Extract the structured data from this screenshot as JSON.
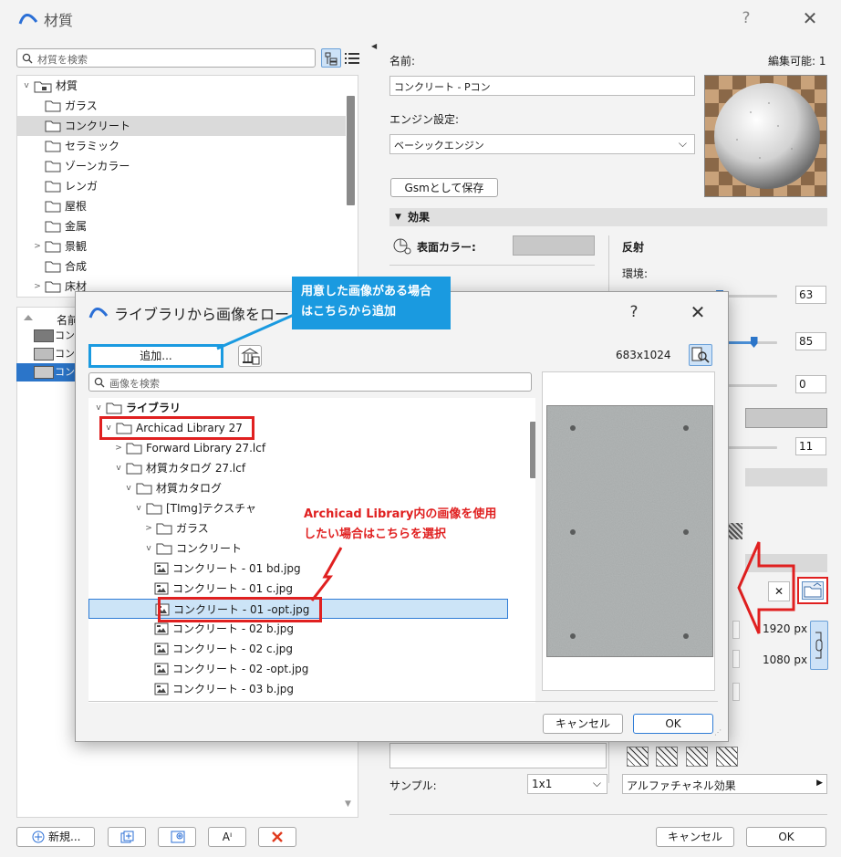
{
  "window": {
    "title": "材質",
    "help": "?",
    "close": "✕"
  },
  "left_pane": {
    "search_placeholder": "材質を検索",
    "tree": {
      "root": "材質",
      "items": [
        {
          "label": "ガラス",
          "expandable": false
        },
        {
          "label": "コンクリート",
          "expandable": false,
          "selected": true
        },
        {
          "label": "セラミック",
          "expandable": false
        },
        {
          "label": "ゾーンカラー",
          "expandable": false
        },
        {
          "label": "レンガ",
          "expandable": false
        },
        {
          "label": "屋根",
          "expandable": false
        },
        {
          "label": "金属",
          "expandable": false
        },
        {
          "label": "景観",
          "expandable": true
        },
        {
          "label": "合成",
          "expandable": false
        },
        {
          "label": "床材",
          "expandable": true
        }
      ]
    },
    "list_header": "名前",
    "list_rows": [
      {
        "label": "コンクリート",
        "swatch": "#7a7a7a"
      },
      {
        "label": "コンクリート",
        "swatch": "#bdbdbd"
      },
      {
        "label": "コンクリート",
        "swatch": "#c9c9c9",
        "selected": true
      }
    ],
    "bottom_buttons": {
      "new": "新規...",
      "rename": "Aᴵ"
    }
  },
  "right_pane": {
    "name_label": "名前:",
    "editable_label": "編集可能: 1",
    "name_value": "コンクリート - Pコン",
    "engine_label": "エンジン設定:",
    "engine_value": "ベーシックエンジン",
    "gsm_button": "Gsmとして保存",
    "effects_header": "効果",
    "surface_color_label": "表面カラー:",
    "reflection_label": "反射",
    "ambient_label": "環境:",
    "sliders": [
      {
        "value": "63",
        "fraction": 0.63
      },
      {
        "value": "85",
        "fraction": 0.85
      },
      {
        "value": "0",
        "fraction": 0.0
      },
      {
        "value": "11",
        "fraction": 0.11
      }
    ],
    "px_width": "1920 px",
    "px_height": "1080 px",
    "clear_button": "✕",
    "sample_label": "サンプル:",
    "sample_value": "1x1",
    "alpha_value": "アルファチャネル効果",
    "cancel_button": "キャンセル",
    "ok_button": "OK"
  },
  "dialog": {
    "title": "ライブラリから画像をロード",
    "help": "?",
    "close": "✕",
    "add_button": "追加...",
    "dimensions": "683x1024",
    "search_placeholder": "画像を検索",
    "tree": [
      {
        "label": "ライブラリ",
        "depth": 0,
        "arrow": "v",
        "type": "folder",
        "bold": true
      },
      {
        "label": "Archicad Library 27",
        "depth": 1,
        "arrow": "v",
        "type": "folder"
      },
      {
        "label": "Forward Library 27.lcf",
        "depth": 2,
        "arrow": ">",
        "type": "folder"
      },
      {
        "label": "材質カタログ 27.lcf",
        "depth": 2,
        "arrow": "v",
        "type": "folder"
      },
      {
        "label": "材質カタログ",
        "depth": 3,
        "arrow": "v",
        "type": "folder"
      },
      {
        "label": "[TImg]テクスチャ",
        "depth": 4,
        "arrow": "v",
        "type": "folder"
      },
      {
        "label": "ガラス",
        "depth": 5,
        "arrow": ">",
        "type": "folder"
      },
      {
        "label": "コンクリート",
        "depth": 5,
        "arrow": "v",
        "type": "folder"
      },
      {
        "label": "コンクリート - 01 bd.jpg",
        "depth": 6,
        "arrow": "",
        "type": "image"
      },
      {
        "label": "コンクリート - 01 c.jpg",
        "depth": 6,
        "arrow": "",
        "type": "image"
      },
      {
        "label": "コンクリート - 01 -opt.jpg",
        "depth": 6,
        "arrow": "",
        "type": "image",
        "selected": true
      },
      {
        "label": "コンクリート - 02 b.jpg",
        "depth": 6,
        "arrow": "",
        "type": "image"
      },
      {
        "label": "コンクリート - 02 c.jpg",
        "depth": 6,
        "arrow": "",
        "type": "image"
      },
      {
        "label": "コンクリート - 02 -opt.jpg",
        "depth": 6,
        "arrow": "",
        "type": "image"
      },
      {
        "label": "コンクリート - 03 b.jpg",
        "depth": 6,
        "arrow": "",
        "type": "image"
      }
    ],
    "cancel_button": "キャンセル",
    "ok_button": "OK"
  },
  "annotations": {
    "blue_callout_line1": "用意した画像がある場合",
    "blue_callout_line2": "はこちらから追加",
    "red_note_line1": "Archicad Library内の画像を使用",
    "red_note_line2": "したい場合はこちらを選択",
    "blue_color": "#1a9ae0",
    "red_color": "#e02020"
  }
}
